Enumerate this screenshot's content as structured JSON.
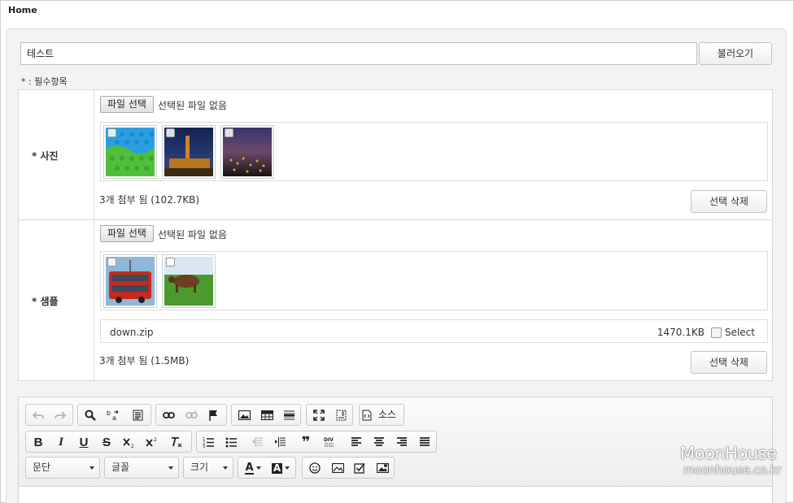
{
  "header": {
    "title": "Home"
  },
  "form": {
    "title_value": "테스트",
    "load_button": "불러오기",
    "required_note": "* : 필수항목"
  },
  "photo_row": {
    "label": "* 사진",
    "file_button": "파일 선택",
    "no_file_text": "선택된 파일 없음",
    "thumbnails": [
      {
        "name": "knit-pattern",
        "colors": [
          "#2a9fe0",
          "#4fbf3a"
        ]
      },
      {
        "name": "castle-night",
        "colors": [
          "#1a2a5c",
          "#c9852e"
        ]
      },
      {
        "name": "city-night",
        "colors": [
          "#2a2550",
          "#b07a30"
        ]
      }
    ],
    "count_text": "3개 첨부 됨 (102.7KB)",
    "delete_button": "선택 삭제"
  },
  "sample_row": {
    "label": "* 샘플",
    "file_button": "파일 선택",
    "no_file_text": "선택된 파일 없음",
    "thumbnails": [
      {
        "name": "red-bus",
        "colors": [
          "#8fb7d8",
          "#c8281e"
        ]
      },
      {
        "name": "cow-field",
        "colors": [
          "#d7e8f2",
          "#4b9a2e"
        ]
      }
    ],
    "file": {
      "name": "down.zip",
      "size": "1470.1KB",
      "select_label": "Select"
    },
    "count_text": "3개 첨부 됨 (1.5MB)",
    "delete_button": "선택 삭제"
  },
  "editor": {
    "source_label": "소스",
    "paragraph_combo": "문단",
    "font_combo": "글꼴",
    "size_combo": "크기",
    "row1_icons": [
      "undo-icon",
      "redo-icon",
      "find-icon",
      "replace-icon",
      "select-all-icon",
      "link-icon",
      "unlink-icon",
      "anchor-icon",
      "image-icon",
      "table-icon",
      "horizontal-rule-icon",
      "maximize-icon",
      "show-blocks-icon",
      "source-icon"
    ],
    "row2_icons": [
      "bold-icon",
      "italic-icon",
      "underline-icon",
      "strike-icon",
      "subscript-icon",
      "superscript-icon",
      "remove-format-icon",
      "numbered-list-icon",
      "bulleted-list-icon",
      "outdent-icon",
      "indent-icon",
      "blockquote-icon",
      "div-icon",
      "align-left-icon",
      "align-center-icon",
      "align-right-icon",
      "justify-icon"
    ],
    "row2_glyphs": {
      "bold": "B",
      "italic": "I",
      "underline": "U",
      "strike": "S",
      "blockquote": "❞"
    },
    "row3_icons": [
      "text-color-icon",
      "background-color-icon",
      "emoji-icon",
      "image-upload-icon",
      "checkbox-icon",
      "image-edit-icon"
    ],
    "text_color_glyph": "A",
    "bg_color_glyph": "A"
  },
  "watermark": {
    "line1": "MoonHouse",
    "line2": "moonhouse.co.kr"
  }
}
